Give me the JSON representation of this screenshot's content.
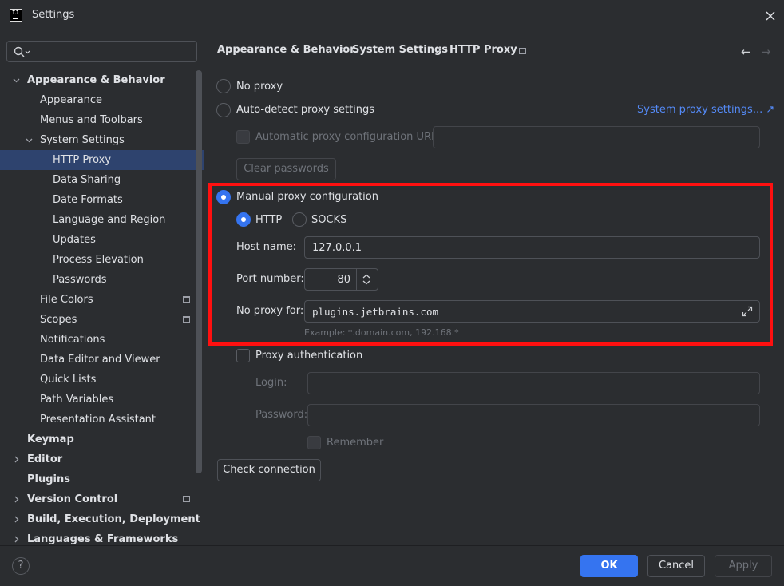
{
  "window": {
    "title": "Settings",
    "app_icon_text": "IJ"
  },
  "search": {
    "placeholder": ""
  },
  "sidebar": {
    "items": [
      {
        "label": "Appearance & Behavior"
      },
      {
        "label": "Appearance"
      },
      {
        "label": "Menus and Toolbars"
      },
      {
        "label": "System Settings"
      },
      {
        "label": "HTTP Proxy"
      },
      {
        "label": "Data Sharing"
      },
      {
        "label": "Date Formats"
      },
      {
        "label": "Language and Region"
      },
      {
        "label": "Updates"
      },
      {
        "label": "Process Elevation"
      },
      {
        "label": "Passwords"
      },
      {
        "label": "File Colors"
      },
      {
        "label": "Scopes"
      },
      {
        "label": "Notifications"
      },
      {
        "label": "Data Editor and Viewer"
      },
      {
        "label": "Quick Lists"
      },
      {
        "label": "Path Variables"
      },
      {
        "label": "Presentation Assistant"
      },
      {
        "label": "Keymap"
      },
      {
        "label": "Editor"
      },
      {
        "label": "Plugins"
      },
      {
        "label": "Version Control"
      },
      {
        "label": "Build, Execution, Deployment"
      },
      {
        "label": "Languages & Frameworks"
      }
    ]
  },
  "breadcrumb": [
    "Appearance & Behavior",
    "System Settings",
    "HTTP Proxy"
  ],
  "breadcrumb_sep": "›",
  "proxy": {
    "no_proxy_label": "No proxy",
    "auto_detect_label": "Auto-detect proxy settings",
    "system_proxy_link": "System proxy settings... ↗",
    "auto_config_url_label": "Automatic proxy configuration URL:",
    "auto_config_url_value": "",
    "clear_passwords_label": "Clear passwords",
    "manual_label": "Manual proxy configuration",
    "http_label": "HTTP",
    "socks_label": "SOCKS",
    "host_label_pre": "H",
    "host_label_post": "ost name:",
    "host_value": "127.0.0.1",
    "port_label_pre": "Port ",
    "port_label_u": "n",
    "port_label_post": "umber:",
    "port_value": "80",
    "no_proxy_for_label": "No proxy for:",
    "no_proxy_for_value": "plugins.jetbrains.com",
    "example_text": "Example: *.domain.com, 192.168.*",
    "auth_label": "Proxy authentication",
    "login_label": "Login:",
    "login_value": "",
    "password_label": "Password:",
    "password_value": "",
    "remember_label": "Remember",
    "check_connection_label": "Check connection"
  },
  "footer": {
    "help_label": "?",
    "ok_label": "OK",
    "cancel_label": "Cancel",
    "apply_label": "Apply"
  },
  "colors": {
    "accent": "#3574f0",
    "highlight": "#ff1010",
    "link": "#548af7",
    "background": "#2b2d30",
    "selection": "#2e436e"
  }
}
